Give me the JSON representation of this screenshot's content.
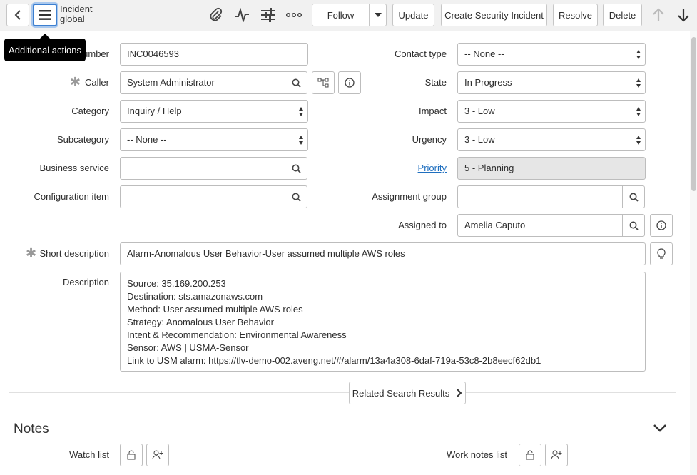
{
  "header": {
    "title_line1": "Incident",
    "title_line2": "global",
    "follow_label": "Follow",
    "update_label": "Update",
    "create_security_label": "Create Security Incident",
    "resolve_label": "Resolve",
    "delete_label": "Delete"
  },
  "tooltip": "Additional actions",
  "form": {
    "number_label": "Number",
    "number_label_visible": "umber",
    "number_value": "INC0046593",
    "caller_label": "Caller",
    "caller_value": "System Administrator",
    "category_label": "Category",
    "category_value": "Inquiry / Help",
    "subcategory_label": "Subcategory",
    "subcategory_value": "-- None --",
    "business_service_label": "Business service",
    "business_service_value": "",
    "config_item_label": "Configuration item",
    "config_item_value": "",
    "contact_type_label": "Contact type",
    "contact_type_value": "-- None --",
    "state_label": "State",
    "state_value": "In Progress",
    "impact_label": "Impact",
    "impact_value": "3 - Low",
    "urgency_label": "Urgency",
    "urgency_value": "3 - Low",
    "priority_label": "Priority",
    "priority_value": "5 - Planning",
    "assignment_group_label": "Assignment group",
    "assignment_group_value": "",
    "assigned_to_label": "Assigned to",
    "assigned_to_value": "Amelia Caputo",
    "short_description_label": "Short description",
    "short_description_value": "Alarm-Anomalous User Behavior-User assumed multiple AWS roles",
    "description_label": "Description",
    "description_lines": [
      "Source: 35.169.200.253",
      "Destination: sts.amazonaws.com",
      "Method: User assumed multiple AWS roles",
      "Strategy: Anomalous User Behavior",
      "Intent & Recommendation: Environmental Awareness",
      "Sensor: AWS | USMA-Sensor",
      "Link to USM alarm: https://tlv-demo-002.aveng.net/#/alarm/13a4a308-6daf-719a-53c8-2b8eecf62db1"
    ]
  },
  "related_search_label": "Related Search Results",
  "notes": {
    "title": "Notes",
    "watch_list_label": "Watch list",
    "work_notes_list_label": "Work notes list"
  }
}
